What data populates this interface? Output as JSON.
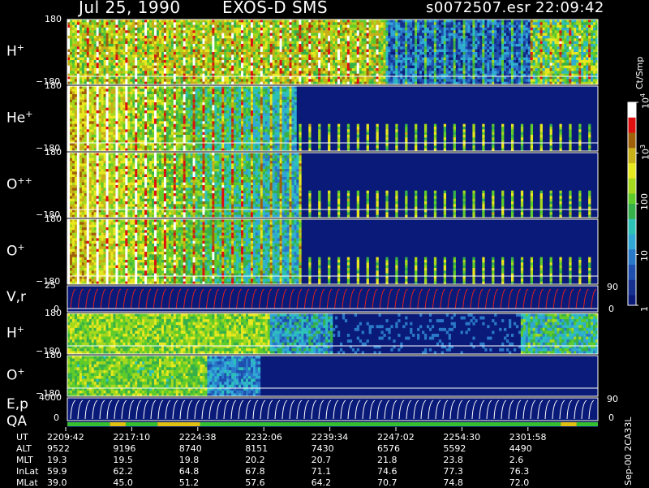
{
  "header": {
    "date": "Jul 25, 1990",
    "instrument": "EXOS-D SMS",
    "filename": "s0072507.esr",
    "time": "22:09:42"
  },
  "chart_data": {
    "type": "heatmap",
    "panels": [
      {
        "label": "H",
        "charge": "+",
        "ytick_top": "180",
        "ytick_bottom": "−180",
        "ylim": [
          -180,
          180
        ]
      },
      {
        "label": "He",
        "charge": "+",
        "ytick_top": "180",
        "ytick_bottom": "−180",
        "ylim": [
          -180,
          180
        ]
      },
      {
        "label": "O",
        "charge": "++",
        "ytick_top": "180",
        "ytick_bottom": "−180",
        "ylim": [
          -180,
          180
        ]
      },
      {
        "label": "O",
        "charge": "+",
        "ytick_top": "180",
        "ytick_bottom": "−180",
        "ylim": [
          -180,
          180
        ]
      },
      {
        "label": "V,r",
        "charge": "",
        "ytick_top": "25",
        "ytick_bottom": "0",
        "right_top": "90",
        "right_bottom": "0"
      },
      {
        "label": "H",
        "charge": "+",
        "ytick_top": "180",
        "ytick_bottom": "−180",
        "ylim": [
          -180,
          180
        ]
      },
      {
        "label": "O",
        "charge": "+",
        "ytick_top": "180",
        "ytick_bottom": "−180",
        "ylim": [
          -180,
          180
        ]
      },
      {
        "label": "E,p",
        "charge": "",
        "ytick_top": "4000",
        "ytick_bottom": "0",
        "right_top": "90",
        "right_bottom": "0"
      },
      {
        "label": "QA",
        "charge": ""
      }
    ],
    "colorbar": {
      "label": "Ct/Smp",
      "ticks": [
        {
          "base": "10",
          "exp": "4",
          "value": 10000
        },
        {
          "base": "10",
          "exp": "3",
          "value": 1000
        },
        {
          "base": "100",
          "exp": "",
          "value": 100
        },
        {
          "base": "10",
          "exp": "",
          "value": 10
        },
        {
          "base": "1",
          "exp": "",
          "value": 1
        }
      ]
    },
    "footer_right": "Sep-00  2CA33L",
    "table": {
      "row_labels": [
        "UT",
        "ALT",
        "MLT",
        "InLat",
        "MLat"
      ],
      "columns": [
        {
          "UT": "2209:42",
          "ALT": "9522",
          "MLT": "19.3",
          "InLat": "59.9",
          "MLat": "39.0"
        },
        {
          "UT": "2217:10",
          "ALT": "9196",
          "MLT": "19.5",
          "InLat": "62.2",
          "MLat": "45.0"
        },
        {
          "UT": "2224:38",
          "ALT": "8740",
          "MLT": "19.8",
          "InLat": "64.8",
          "MLat": "51.2"
        },
        {
          "UT": "2232:06",
          "ALT": "8151",
          "MLT": "20.2",
          "InLat": "67.8",
          "MLat": "57.6"
        },
        {
          "UT": "2239:34",
          "ALT": "7430",
          "MLT": "20.7",
          "InLat": "71.1",
          "MLat": "64.2"
        },
        {
          "UT": "2247:02",
          "ALT": "6576",
          "MLT": "21.8",
          "InLat": "74.6",
          "MLat": "70.7"
        },
        {
          "UT": "2254:30",
          "ALT": "5592",
          "MLT": "23.8",
          "InLat": "77.3",
          "MLat": "74.8"
        },
        {
          "UT": "2301:58",
          "ALT": "4490",
          "MLT": "2.6",
          "InLat": "76.3",
          "MLat": "72.0"
        }
      ]
    }
  }
}
